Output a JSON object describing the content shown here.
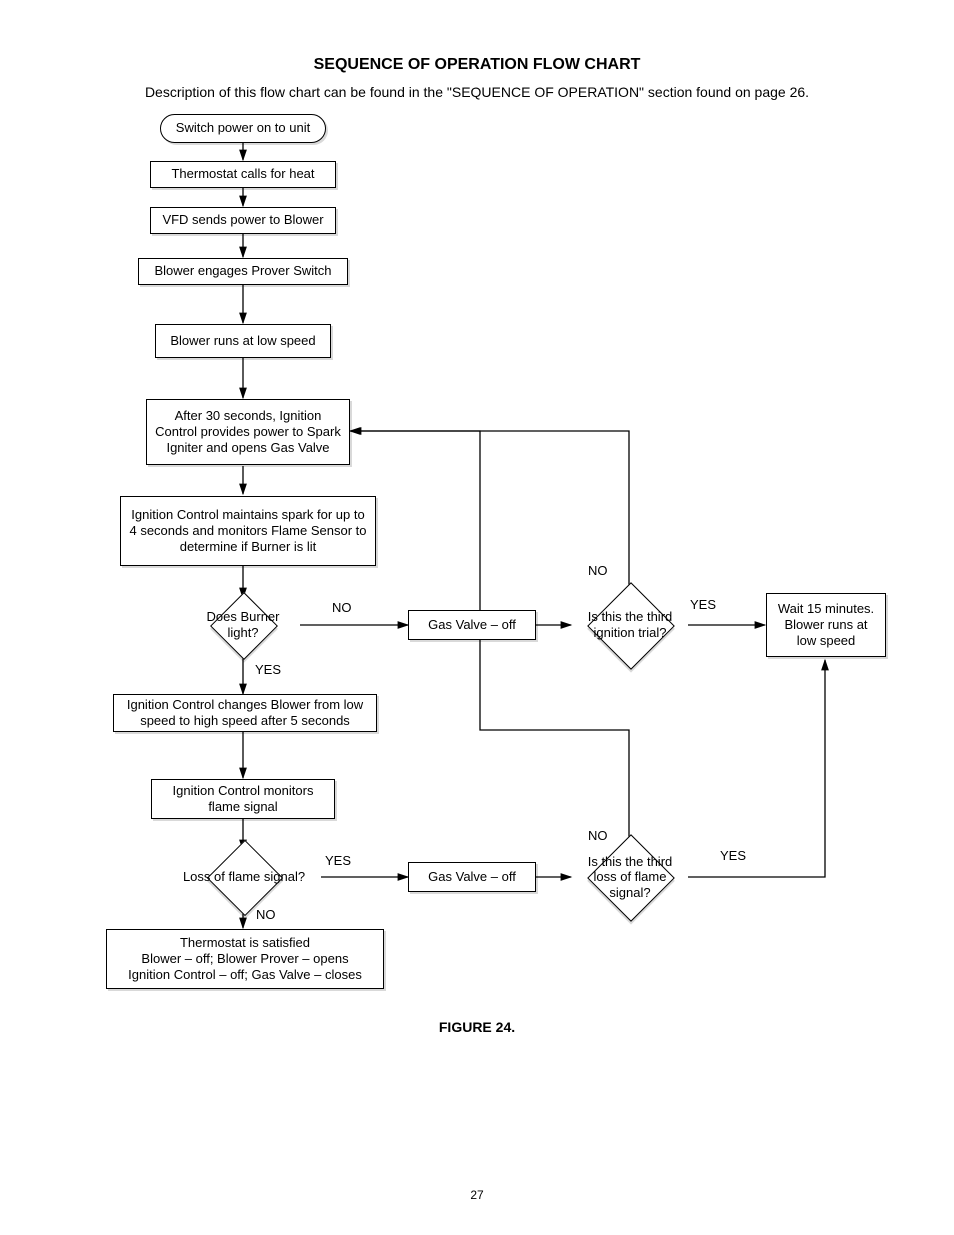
{
  "doc": {
    "title": "SEQUENCE OF OPERATION FLOW CHART",
    "description": "Description of this flow chart can be found in the \"SEQUENCE OF OPERATION\" section found on page 26.",
    "caption": "FIGURE 24.",
    "page_number": "27"
  },
  "nodes": {
    "start": "Switch power on to unit",
    "thermostat_calls": "Thermostat calls for heat",
    "vfd_power": "VFD sends power to Blower",
    "prover_switch": "Blower engages Prover Switch",
    "low_speed": "Blower runs at low speed",
    "ignition_30s": "After 30 seconds, Ignition Control provides power to Spark Igniter and opens Gas Valve",
    "maintain_spark": "Ignition Control maintains spark for up to 4 seconds and monitors Flame Sensor to determine if Burner is lit",
    "burner_light": "Does Burner light?",
    "gas_off_1": "Gas Valve – off",
    "third_trial": "Is this the third ignition trial?",
    "wait_15": "Wait 15 minutes. Blower runs at low speed",
    "high_speed": "Ignition Control changes Blower from low speed to high speed after 5 seconds",
    "monitor_flame": "Ignition Control monitors flame signal",
    "loss_flame": "Loss of flame signal?",
    "gas_off_2": "Gas Valve – off",
    "third_loss": "Is this the third loss of flame signal?",
    "satisfied": "Thermostat is satisfied\nBlower – off; Blower Prover – opens\nIgnition Control – off; Gas Valve – closes"
  },
  "labels": {
    "no": "NO",
    "yes": "YES"
  }
}
